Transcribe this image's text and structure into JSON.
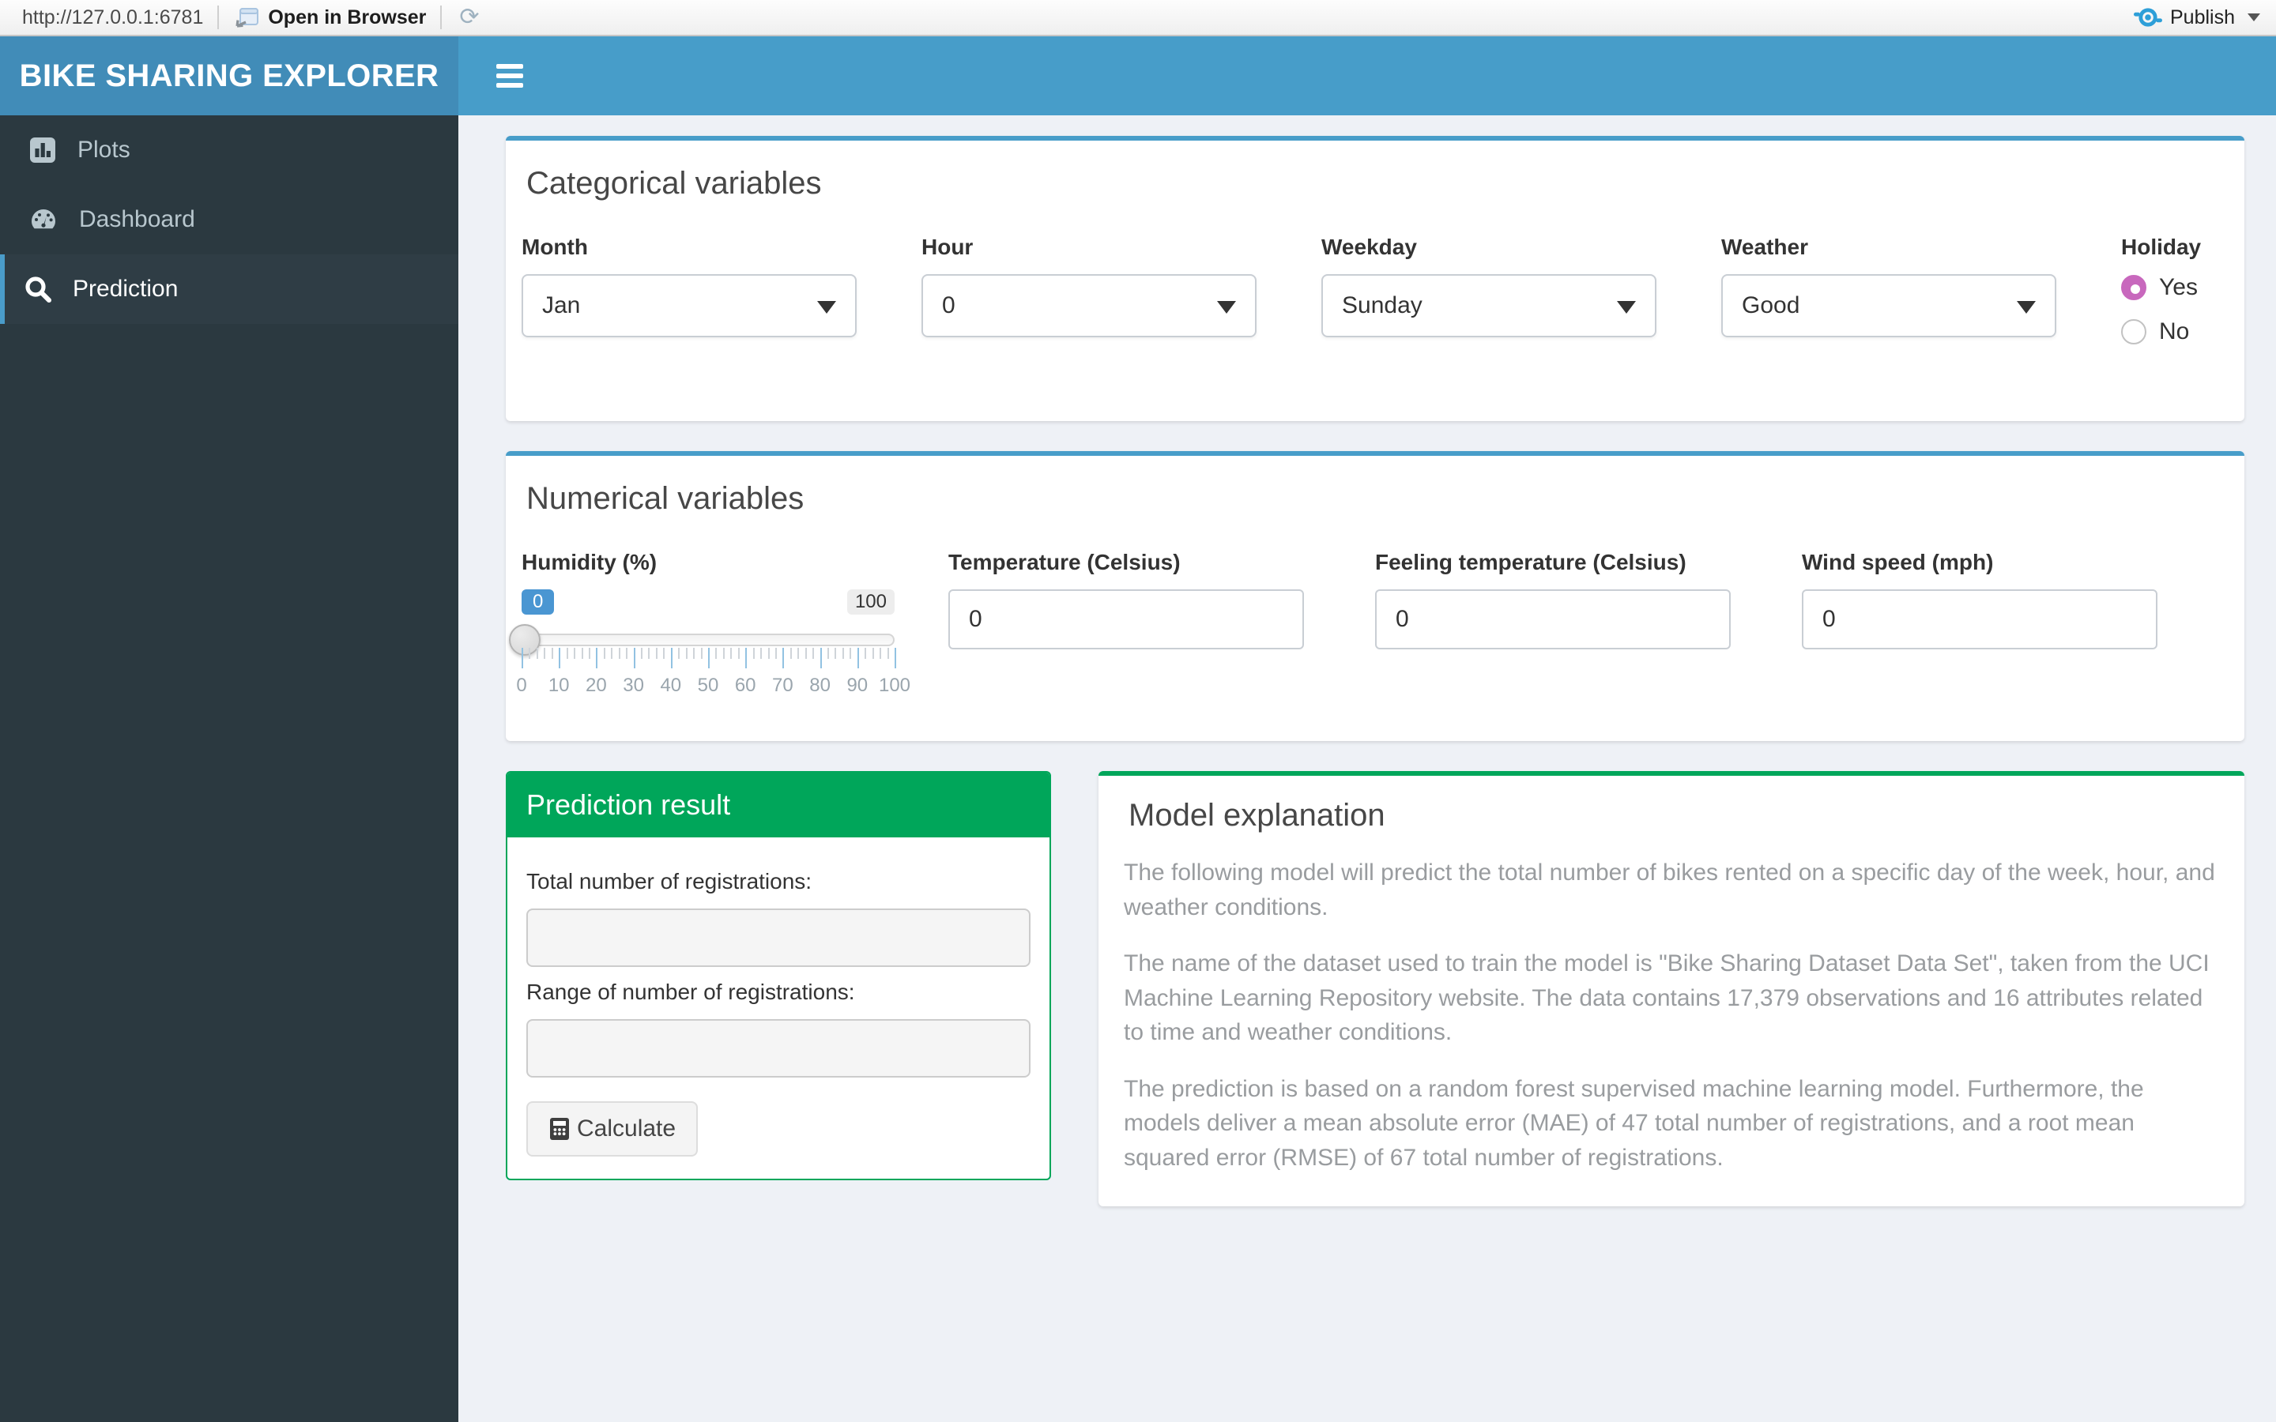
{
  "browser_bar": {
    "url": "http://127.0.0.1:6781",
    "open_in_browser": "Open in Browser",
    "publish": "Publish"
  },
  "header": {
    "title": "BIKE SHARING EXPLORER"
  },
  "sidebar": {
    "items": [
      {
        "label": "Plots",
        "icon": "bar-chart-icon",
        "active": false
      },
      {
        "label": "Dashboard",
        "icon": "gauge-icon",
        "active": false
      },
      {
        "label": "Prediction",
        "icon": "search-icon",
        "active": true
      }
    ]
  },
  "categorical": {
    "title": "Categorical variables",
    "fields": [
      {
        "label": "Month",
        "value": "Jan"
      },
      {
        "label": "Hour",
        "value": "0"
      },
      {
        "label": "Weekday",
        "value": "Sunday"
      },
      {
        "label": "Weather",
        "value": "Good"
      }
    ],
    "holiday": {
      "label": "Holiday",
      "options": [
        {
          "label": "Yes",
          "selected": true
        },
        {
          "label": "No",
          "selected": false
        }
      ]
    }
  },
  "numerical": {
    "title": "Numerical variables",
    "slider": {
      "label": "Humidity (%)",
      "value": "0",
      "max_label": "100",
      "min": 0,
      "max": 100,
      "minor_step": 2,
      "major_step": 10,
      "ticks": [
        0,
        10,
        20,
        30,
        40,
        50,
        60,
        70,
        80,
        90,
        100
      ]
    },
    "inputs": [
      {
        "label": "Temperature (Celsius)",
        "value": "0"
      },
      {
        "label": "Feeling temperature (Celsius)",
        "value": "0"
      },
      {
        "label": "Wind speed (mph)",
        "value": "0"
      }
    ]
  },
  "prediction": {
    "title": "Prediction result",
    "total_label": "Total number of registrations:",
    "total_value": "",
    "range_label": "Range of number of registrations:",
    "range_value": "",
    "button": "Calculate"
  },
  "model": {
    "title": "Model explanation",
    "paragraphs": [
      "The following model will predict the total number of bikes rented on a specific day of the week, hour, and weather conditions.",
      "The name of the dataset used to train the model is \"Bike Sharing Dataset Data Set\", taken from the UCI Machine Learning Repository website. The data contains 17,379 observations and 16 attributes related to time and weather conditions.",
      "The prediction is based on a random forest supervised machine learning model. Furthermore, the models deliver a mean absolute error (MAE) of 47 total number of registrations, and a root mean squared error (RMSE) of 67 total number of registrations."
    ]
  },
  "colors": {
    "logo_bg": "#418cb8",
    "navbar_bg": "#479dc9",
    "sidebar_bg": "#2b3940",
    "sidebar_active_bg": "#2f3d45",
    "box_accent_blue": "#479dc9",
    "box_accent_green": "#00a65a",
    "radio_selected_pink": "#c868bd",
    "slider_badge_blue": "#4a96d2",
    "body_bg": "#eef1f6"
  }
}
